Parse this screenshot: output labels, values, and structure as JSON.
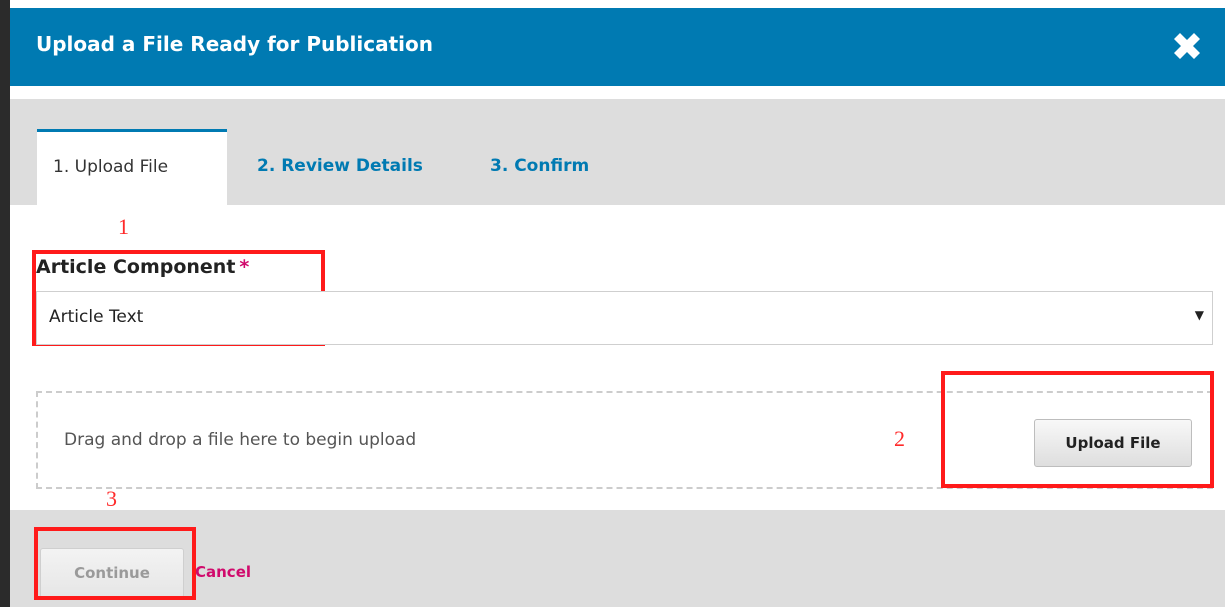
{
  "dialog": {
    "title": "Upload a File Ready for Publication",
    "close_icon": "close-x-icon"
  },
  "tabs": [
    {
      "label": "1. Upload File",
      "active": true
    },
    {
      "label": "2. Review Details",
      "active": false
    },
    {
      "label": "3. Confirm",
      "active": false
    }
  ],
  "form": {
    "component_label": "Article Component",
    "required_marker": "*",
    "component_value": "Article Text",
    "select_arrow": "▼"
  },
  "dropzone": {
    "text": "Drag and drop a file here to begin upload",
    "upload_button": "Upload File"
  },
  "footer": {
    "continue_label": "Continue",
    "cancel_label": "Cancel"
  },
  "annotations": [
    "1",
    "2",
    "3"
  ],
  "colors": {
    "header_bg": "#007ab2",
    "accent": "#d00a6c",
    "annotation_red": "#ff1a1a"
  }
}
